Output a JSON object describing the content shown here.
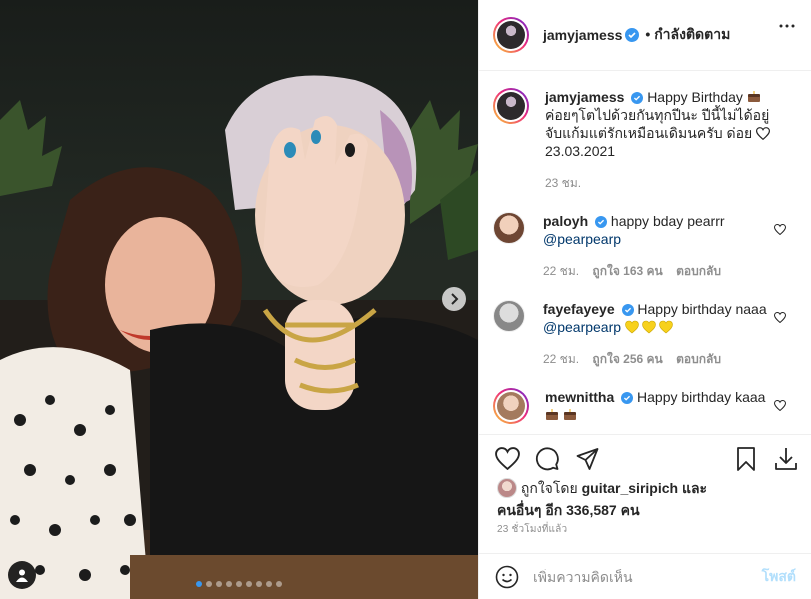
{
  "header": {
    "username": "jamyjamess",
    "follow_label": "• กำลังติดตาม"
  },
  "caption": {
    "username": "jamyjamess",
    "text_line1": "Happy Birthday",
    "text_line2": "ค่อยๆโตไปด้วยกันทุกปีนะ ปีนี้ไม่ได้อยู่จับแก้มแต่รักเหมือนเดิมนครับ ด่อย",
    "date": "23.03.2021",
    "time": "23 ชม."
  },
  "comments": [
    {
      "username": "paloyh",
      "text": "happy bday pearrr",
      "mention": "@pearpearp",
      "time": "22 ชม.",
      "likes": "ถูกใจ 163 คน",
      "reply": "ตอบกลับ"
    },
    {
      "username": "fayefayeye",
      "text": "Happy birthday naaa",
      "mention": "@pearpearp",
      "time": "22 ชม.",
      "likes": "ถูกใจ 256 คน",
      "reply": "ตอบกลับ"
    },
    {
      "username": "mewnittha",
      "text": "Happy birthday kaaa"
    }
  ],
  "likes": {
    "prefix": "ถูกใจโดย",
    "user": "guitar_siripich",
    "conj": "และ",
    "others": "คนอื่นๆ อีก 336,587 คน"
  },
  "timestamp": "23 ชั่วโมงที่แล้ว",
  "add_comment": {
    "placeholder": "เพิ่มความคิดเห็น",
    "post_label": "โพสต์"
  },
  "icons": {
    "verified": "verified-badge-icon",
    "like": "heart-icon",
    "comment": "comment-icon",
    "share": "share-icon",
    "save": "bookmark-icon",
    "download": "download-icon",
    "emoji": "emoji-icon",
    "next": "chevron-right-icon",
    "more": "more-icon",
    "tag": "user-tag-icon"
  },
  "colors": {
    "verified": "#3897f0",
    "mention": "#00376b",
    "post_button": "#b2dffc",
    "meta": "#8e8e8e"
  },
  "carousel": {
    "total": 9,
    "active": 1
  }
}
